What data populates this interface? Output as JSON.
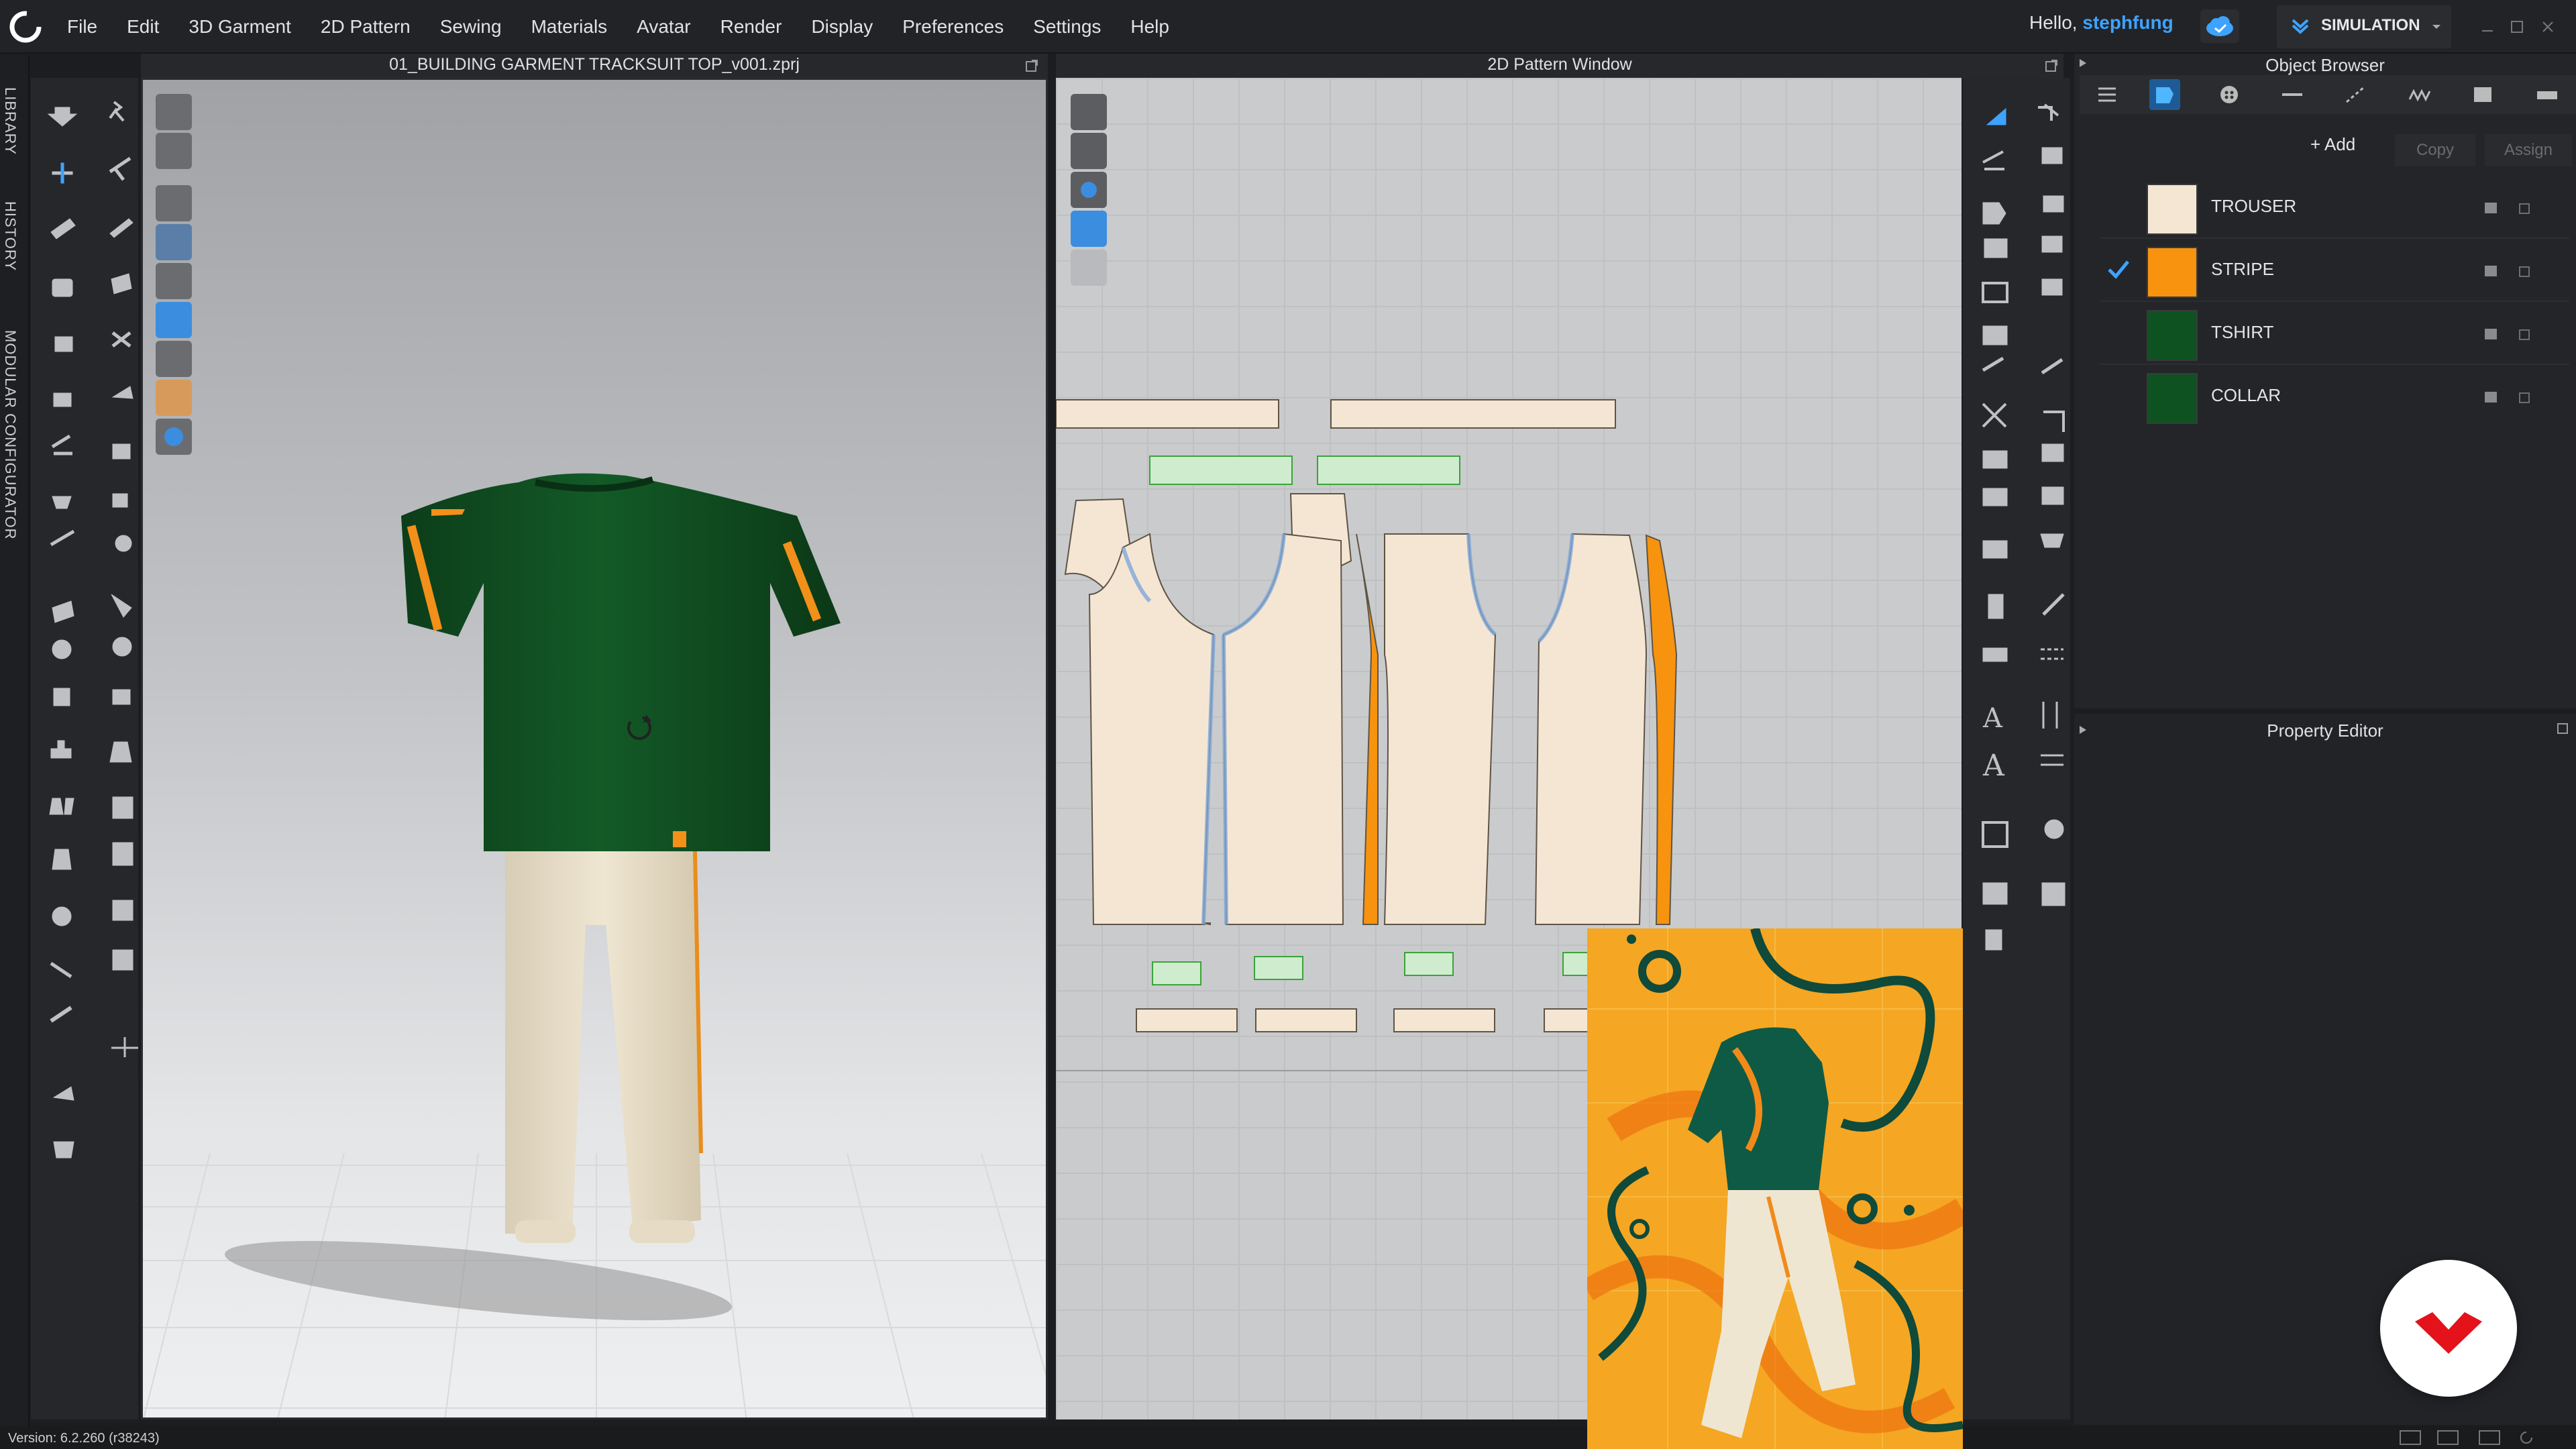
{
  "menu": [
    "File",
    "Edit",
    "3D Garment",
    "2D Pattern",
    "Sewing",
    "Materials",
    "Avatar",
    "Render",
    "Display",
    "Preferences",
    "Settings",
    "Help"
  ],
  "user": {
    "greeting": "Hello,",
    "name": "stephfung"
  },
  "mode": {
    "label": "SIMULATION"
  },
  "side_tabs": [
    "LIBRARY",
    "HISTORY",
    "MODULAR CONFIGURATOR"
  ],
  "viewport": {
    "title": "01_BUILDING GARMENT TRACKSUIT TOP_v001.zprj"
  },
  "pattern_window": {
    "title": "2D Pattern Window"
  },
  "object_browser": {
    "title": "Object Browser",
    "add_label": "+ Add",
    "copy_label": "Copy",
    "assign_label": "Assign",
    "fabrics": [
      {
        "name": "TROUSER",
        "color": "#f5e6d4",
        "checked": false
      },
      {
        "name": "STRIPE",
        "color": "#f7930e",
        "checked": true
      },
      {
        "name": "TSHIRT",
        "color": "#0e5222",
        "checked": false
      },
      {
        "name": "COLLAR",
        "color": "#0e5222",
        "checked": false
      }
    ]
  },
  "property_editor": {
    "title": "Property Editor"
  },
  "status": {
    "version": "Version: 6.2.260 (r38243)"
  },
  "colors": {
    "accent": "#3ea3ff",
    "stripe": "#f7930e",
    "tshirt": "#0e5222",
    "trouser": "#f5e6d4"
  }
}
